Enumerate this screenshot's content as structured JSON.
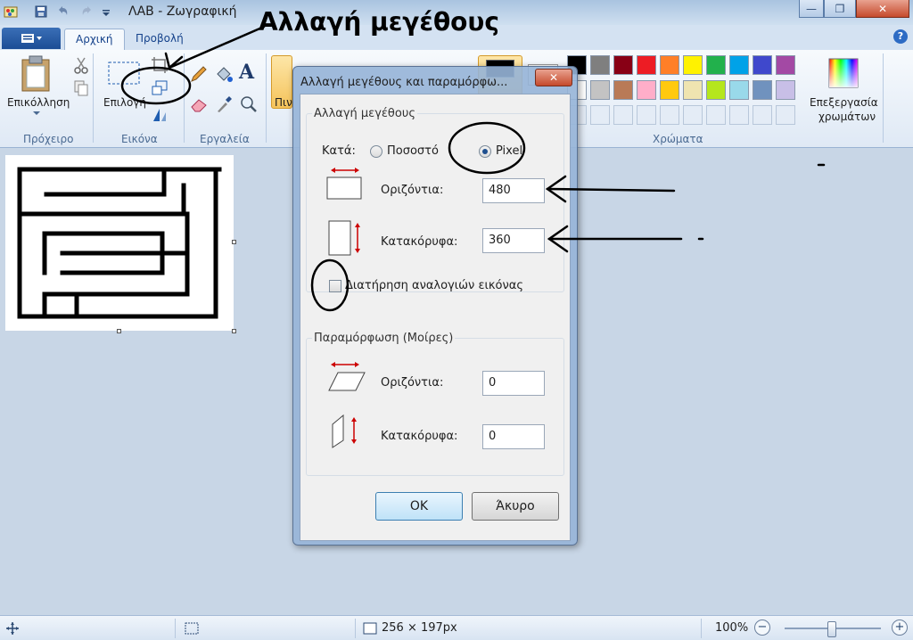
{
  "window": {
    "title": "ΛΑΒ - Ζωγραφική",
    "minimize": "—",
    "maximize": "❐",
    "close": "✕"
  },
  "tabs": [
    {
      "label": "Αρχική",
      "active": true
    },
    {
      "label": "Προβολή",
      "active": false
    }
  ],
  "help": "?",
  "ribbon": {
    "groups": {
      "clipboard": "Πρόχειρο",
      "image": "Εικόνα",
      "tools": "Εργαλεία",
      "colors": "Χρώματα"
    },
    "paste_label": "Επικόλληση",
    "select_label": "Επιλογή",
    "brushes_label": "Πιν",
    "edit_colors_line1": "Επεξεργασία",
    "edit_colors_line2": "χρωμάτων",
    "palette_row1": [
      "#000000",
      "#7f7f7f",
      "#880015",
      "#ed1c24",
      "#ff7f27",
      "#fff200",
      "#22b14c",
      "#00a2e8",
      "#3f48cc",
      "#a349a4"
    ],
    "palette_row2": [
      "#ffffff",
      "#c3c3c3",
      "#b97a57",
      "#ffaec9",
      "#ffc90e",
      "#efe4b0",
      "#b5e61d",
      "#99d9ea",
      "#7092be",
      "#c8bfe7"
    ]
  },
  "annotation": {
    "title": "Αλλαγή μεγέθους"
  },
  "dialog": {
    "title": "Αλλαγή μεγέθους και παραμόρφω...",
    "close": "✕",
    "resize_group": "Αλλαγή μεγέθους",
    "by_label": "Κατά:",
    "percent_label": "Ποσοστό",
    "pixel_label": "Pixel",
    "horizontal_label": "Οριζόντια:",
    "vertical_label": "Κατακόρυφα:",
    "width_value": "480",
    "height_value": "360",
    "keep_ratio_label": "Διατήρηση αναλογιών εικόνας",
    "skew_group": "Παραμόρφωση (Μοίρες)",
    "skew_h_label": "Οριζόντια:",
    "skew_v_label": "Κατακόρυφα:",
    "skew_h_value": "0",
    "skew_v_value": "0",
    "ok": "OK",
    "cancel": "Άκυρο"
  },
  "statusbar": {
    "image_size": "256 × 197px",
    "zoom": "100%",
    "zoom_out": "−",
    "zoom_in": "+"
  }
}
